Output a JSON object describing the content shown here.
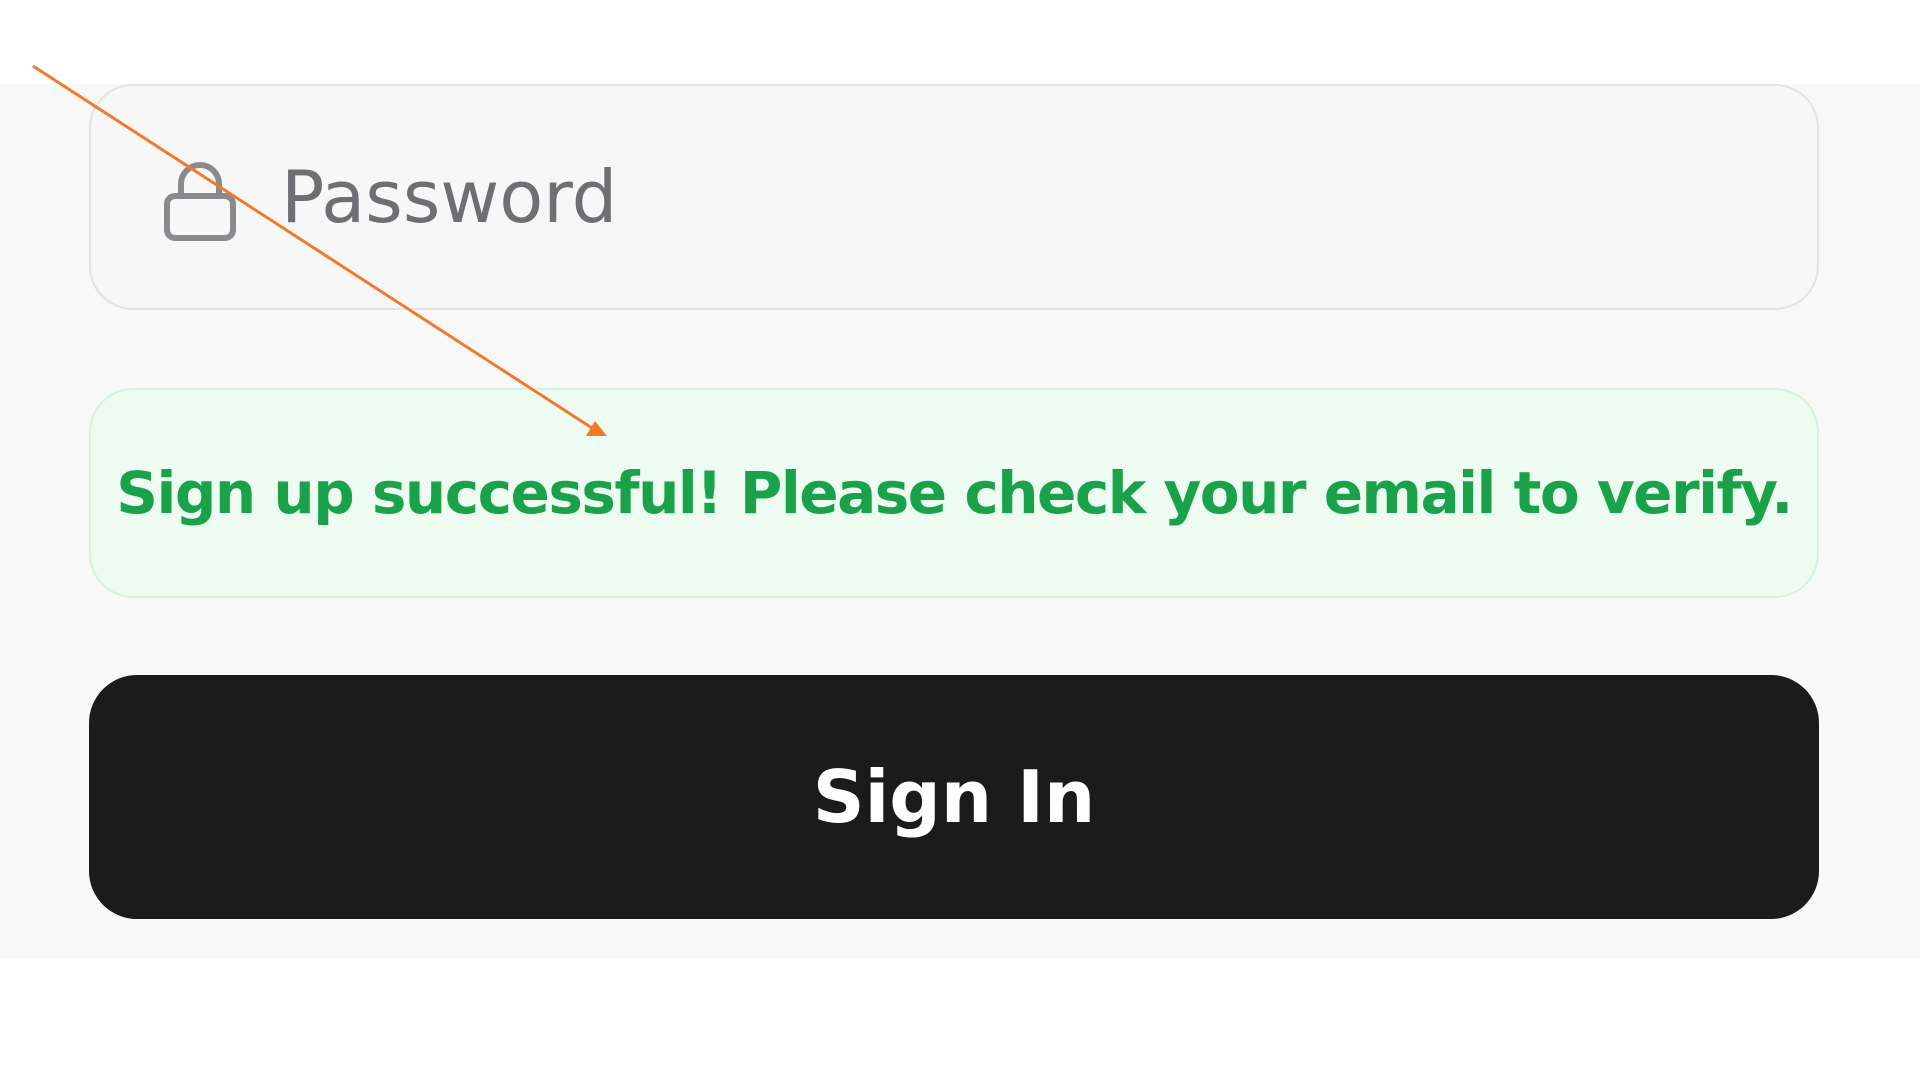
{
  "password_field": {
    "placeholder": "Password",
    "value": "",
    "icon": "lock-icon"
  },
  "alert": {
    "message": "Sign up successful! Please check your email to verify.",
    "color": "#1aa24b",
    "background": "#edfbf1"
  },
  "sign_in_button": {
    "label": "Sign In",
    "background": "#1b1b1c"
  },
  "annotation": {
    "type": "arrow",
    "color": "#f07a2a",
    "points_to": "success-alert"
  }
}
